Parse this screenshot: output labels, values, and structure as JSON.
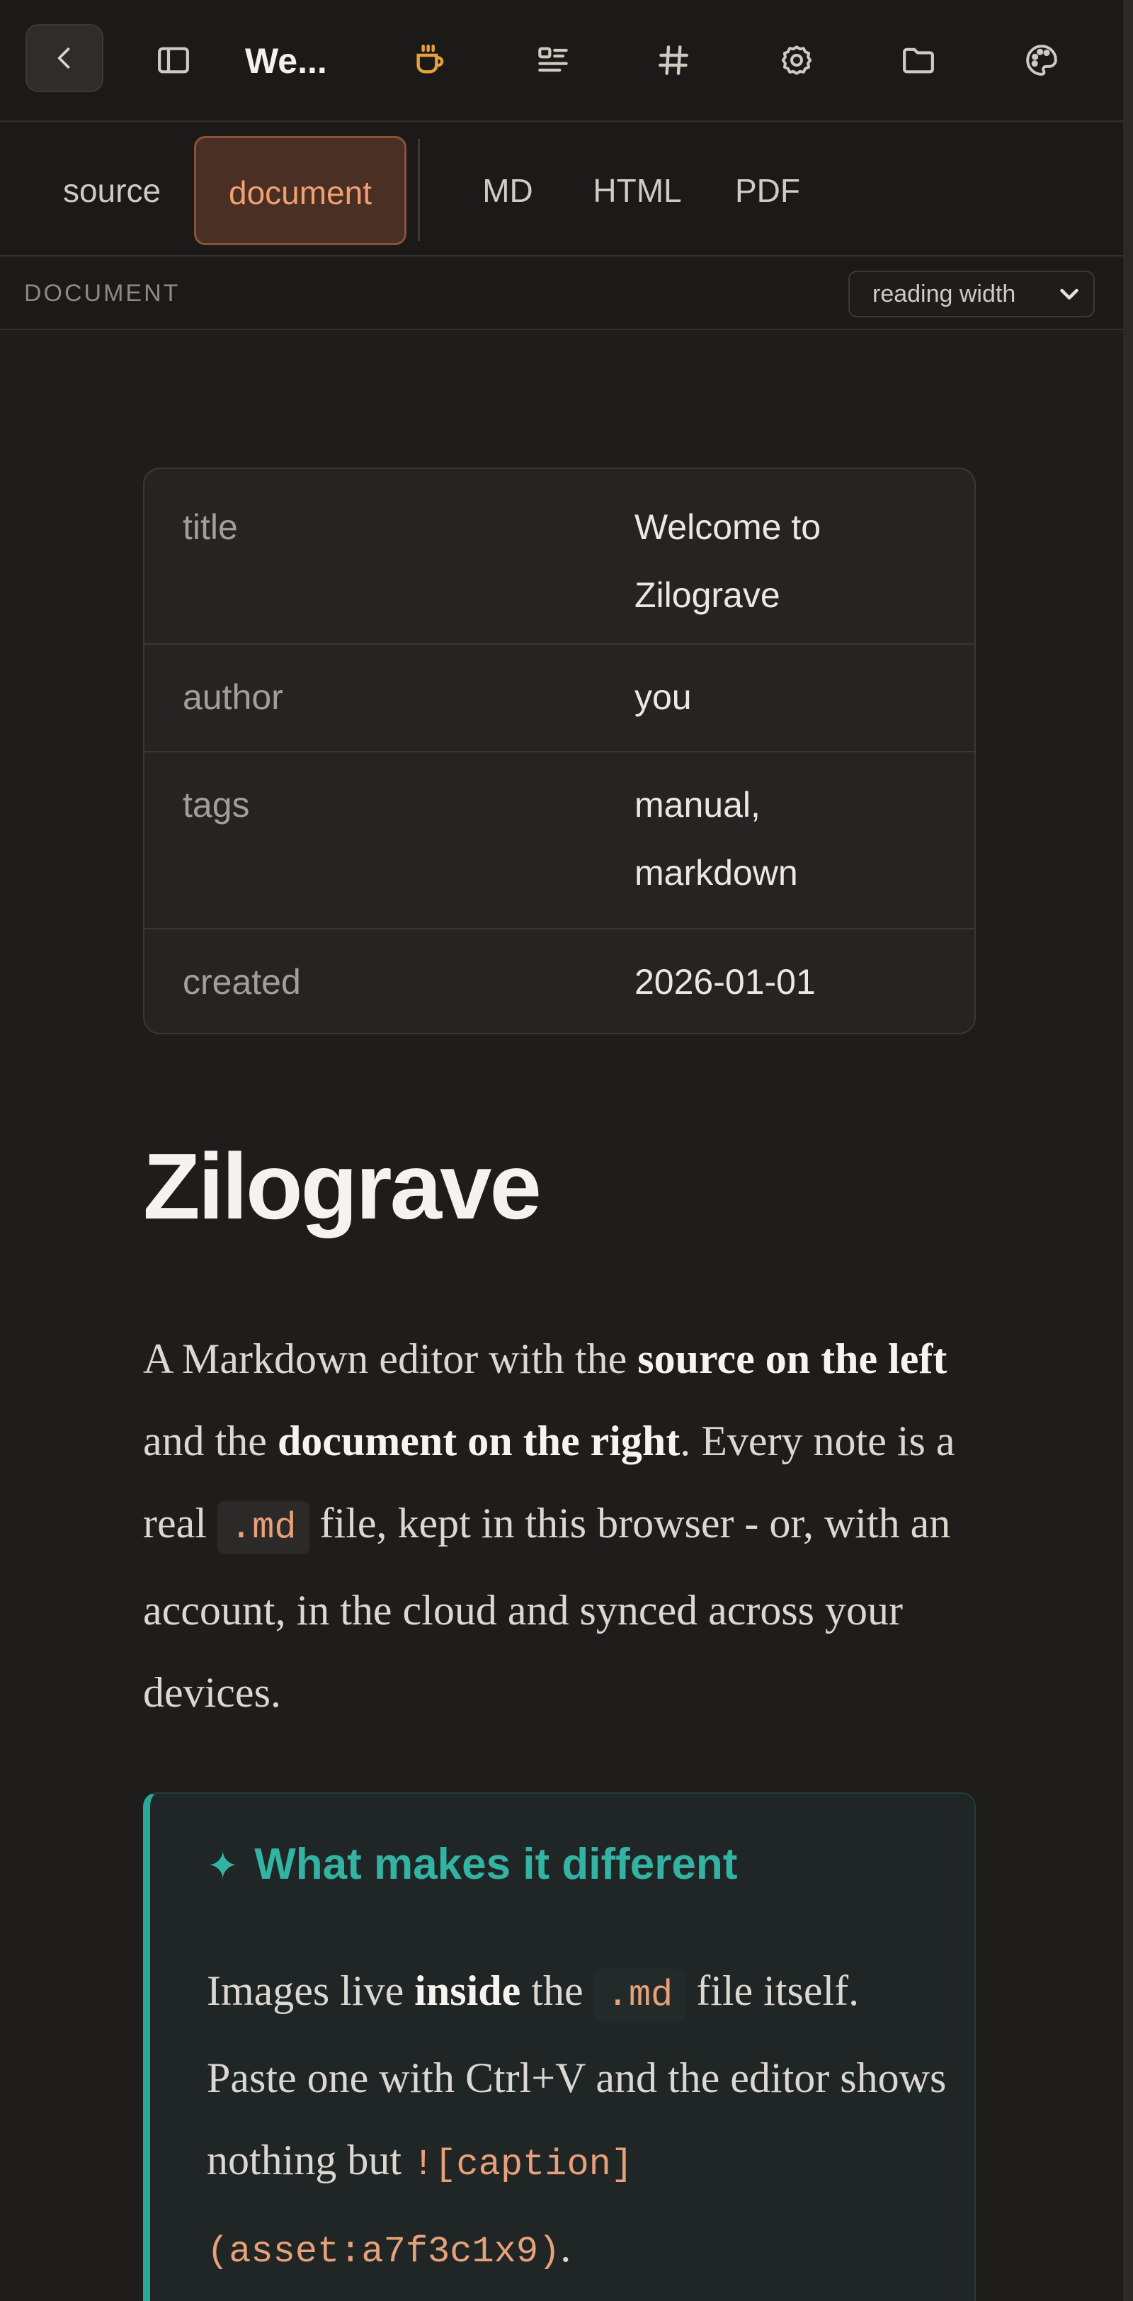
{
  "toolbar": {
    "title": "We...",
    "icons": [
      "chevron-left-icon",
      "sidebar-icon",
      "coffee-icon",
      "outline-icon",
      "hash-icon",
      "gear-icon",
      "folder-icon",
      "palette-icon"
    ],
    "accent": "#e8a13a"
  },
  "tabs": {
    "source": "source",
    "document": "document",
    "md": "MD",
    "html": "HTML",
    "pdf": "PDF"
  },
  "subheader": {
    "label": "DOCUMENT",
    "width_select": "reading width"
  },
  "frontmatter": {
    "rows": [
      {
        "key": "title",
        "value_lines": [
          "Welcome to",
          "Zilograve"
        ]
      },
      {
        "key": "author",
        "value_lines": [
          "you"
        ]
      },
      {
        "key": "tags",
        "value_lines": [
          "manual,",
          "markdown"
        ]
      },
      {
        "key": "created",
        "value_lines": [
          "2026-01-01"
        ]
      }
    ]
  },
  "document": {
    "heading": "Zilograve",
    "intro": {
      "t1": "A Markdown editor with the ",
      "b1": "source on the left",
      "t2": " and the ",
      "b2": "document on the right",
      "t3": ". Every note is a real ",
      "code1": ".md",
      "t4": " file, kept in this browser - or, with an account, in the cloud and synced across your devices."
    },
    "callout": {
      "title": "What makes it different",
      "t1": "Images live ",
      "b1": "inside",
      "t2": " the ",
      "code1": ".md",
      "t3": " file itself. Paste one with Ctrl+V and the editor shows nothing but ",
      "code2": "![caption](asset:a7f3c1x9)",
      "t4": "."
    }
  }
}
